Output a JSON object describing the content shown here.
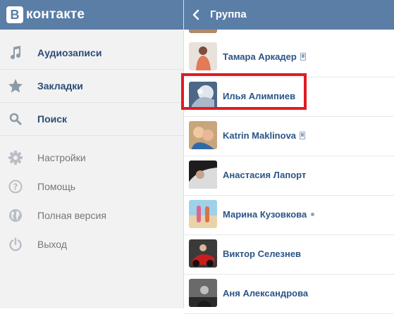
{
  "brand": {
    "logo_letter": "В",
    "name": "контакте"
  },
  "sidebar": {
    "primary": [
      {
        "label": "Аудиозаписи",
        "icon": "music-note-icon"
      },
      {
        "label": "Закладки",
        "icon": "star-icon"
      },
      {
        "label": "Поиск",
        "icon": "search-icon"
      }
    ],
    "secondary": [
      {
        "label": "Настройки",
        "icon": "gear-icon"
      },
      {
        "label": "Помощь",
        "icon": "help-icon"
      },
      {
        "label": "Полная версия",
        "icon": "globe-icon"
      },
      {
        "label": "Выход",
        "icon": "power-icon"
      }
    ]
  },
  "header": {
    "title": "Группа"
  },
  "members": [
    {
      "name": "Тамара Аркадер",
      "status": "mobile"
    },
    {
      "name": "Илья Алимпиев",
      "status": "none",
      "highlighted": true
    },
    {
      "name": "Katrin Maklinova",
      "status": "mobile"
    },
    {
      "name": "Анастасия Лапорт",
      "status": "none"
    },
    {
      "name": "Марина Кузовкова",
      "status": "online"
    },
    {
      "name": "Виктор Селезнев",
      "status": "none"
    },
    {
      "name": "Аня Александрова",
      "status": "none"
    }
  ],
  "colors": {
    "header_bg": "#5a7ea6",
    "link": "#2b5587",
    "highlight": "#e01b24"
  }
}
